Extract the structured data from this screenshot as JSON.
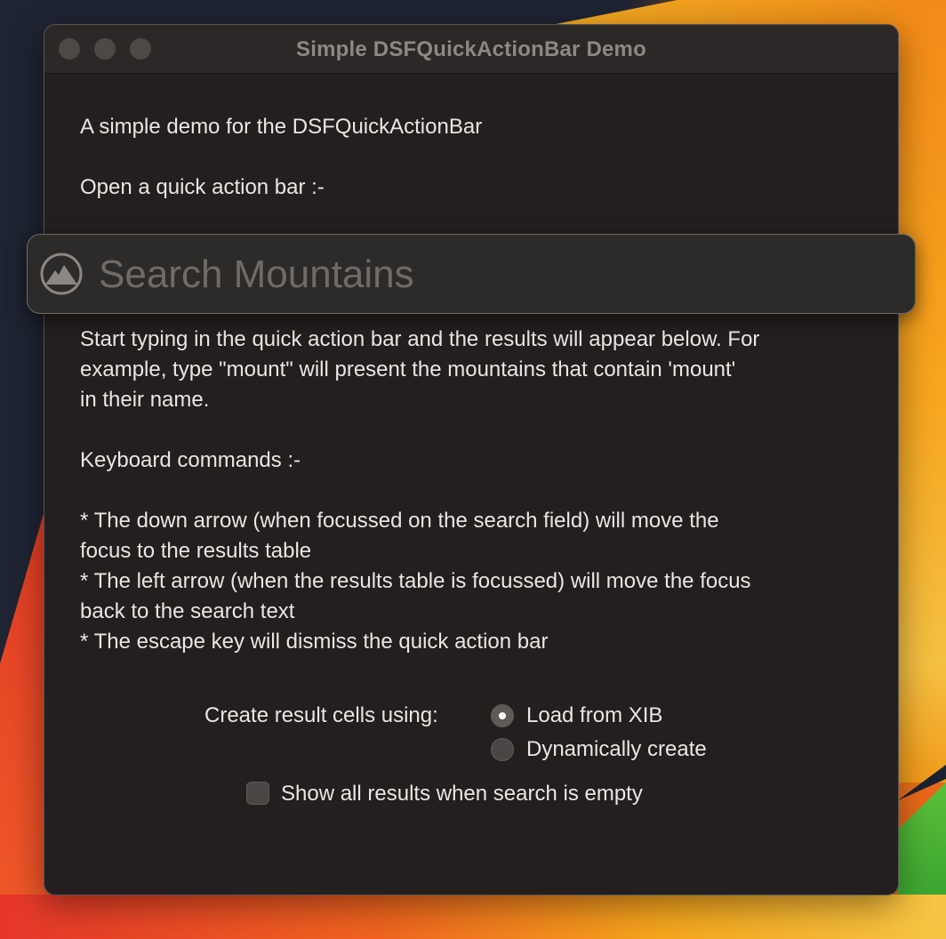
{
  "window": {
    "title": "Simple DSFQuickActionBar Demo"
  },
  "content": {
    "intro": "A simple demo for the DSFQuickActionBar",
    "open_label": "Open a quick action bar :-",
    "description_lines": [
      "Start typing in the quick action bar and the results will appear below. For",
      "example, type \"mount\" will present the mountains that contain 'mount'",
      "in their name."
    ],
    "keyboard_heading": "Keyboard commands :-",
    "keyboard_lines": [
      "* The down arrow (when focussed on the search field) will move the",
      "focus to the results table",
      "* The left arrow (when the results table is focussed) will move the focus",
      "back to the search text",
      "* The escape key will dismiss the quick action bar"
    ]
  },
  "quick_action_bar": {
    "placeholder": "Search Mountains",
    "value": "",
    "icon": "mountain-icon"
  },
  "options": {
    "cells_label": "Create result cells using:",
    "radio_options": [
      {
        "label": "Load from XIB",
        "selected": true
      },
      {
        "label": "Dynamically create",
        "selected": false
      }
    ],
    "checkbox": {
      "label": "Show all results when search is empty",
      "checked": false
    }
  }
}
